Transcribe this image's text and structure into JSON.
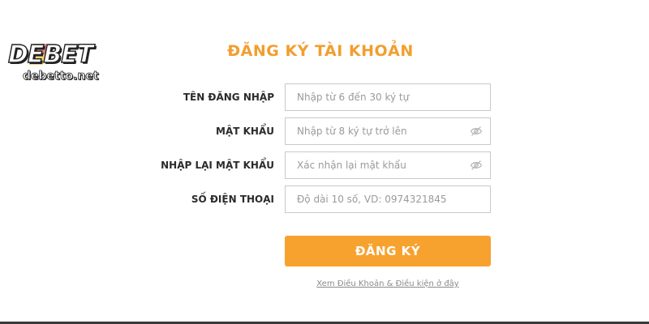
{
  "logo": {
    "brand": "DEBET",
    "domain": "debetto.net"
  },
  "title": "ĐĂNG KÝ TÀI KHOẢN",
  "form": {
    "username": {
      "label": "TÊN ĐĂNG NHẬP",
      "placeholder": "Nhập từ 6 đến 30 ký tự"
    },
    "password": {
      "label": "MẬT KHẨU",
      "placeholder": "Nhập từ 8 ký tự trở lên"
    },
    "confirm_password": {
      "label": "NHẬP LẠI MẬT KHẨU",
      "placeholder": "Xác nhận lại mật khẩu"
    },
    "phone": {
      "label": "SỐ ĐIỆN THOẠI",
      "placeholder": "Độ dài 10 số, VD: 0974321845"
    }
  },
  "submit_label": "ĐĂNG KÝ",
  "terms_link": "Xem Điều Khoản & Điều kiện ở đây",
  "colors": {
    "accent": "#f7a22e",
    "title": "#f29e2e",
    "label": "#2b2b2b",
    "placeholder": "#9a9a9a",
    "input_border": "#c9c9c9"
  },
  "icons": [
    "eye-slash-icon"
  ]
}
